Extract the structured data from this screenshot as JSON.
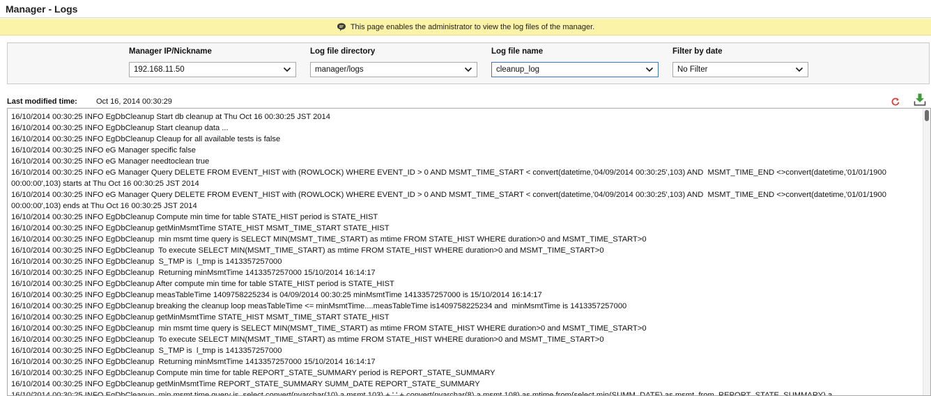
{
  "page": {
    "title": "Manager - Logs"
  },
  "banner": {
    "text": "This page enables the administrator to view the log files of the manager.",
    "icon": "speech-bubble-icon"
  },
  "filters": {
    "manager_ip": {
      "label": "Manager IP/Nickname",
      "value": "192.168.11.50"
    },
    "log_dir": {
      "label": "Log file directory",
      "value": "manager/logs"
    },
    "log_name": {
      "label": "Log file name",
      "value": "cleanup_log"
    },
    "filter_date": {
      "label": "Filter by date",
      "value": "No Filter"
    }
  },
  "meta": {
    "last_modified_label": "Last modified time:",
    "last_modified_value": "Oct 16, 2014 00:30:29",
    "refresh_icon": "refresh-icon",
    "download_icon": "download-icon"
  },
  "colors": {
    "banner_bg": "#fbf3a8",
    "active_border": "#3d76c4",
    "refresh_red": "#d9413a",
    "download_green": "#3e9a3a"
  },
  "log": {
    "lines": [
      "16/10/2014 00:30:25 INFO EgDbCleanup Start db cleanup at Thu Oct 16 00:30:25 JST 2014",
      "16/10/2014 00:30:25 INFO EgDbCleanup Start cleanup data ...",
      "16/10/2014 00:30:25 INFO EgDbCleanup Cleaup for all available tests is false",
      "16/10/2014 00:30:25 INFO eG Manager specific false",
      "16/10/2014 00:30:25 INFO eG Manager needtoclean true",
      "16/10/2014 00:30:25 INFO eG Manager Query DELETE FROM EVENT_HIST with (ROWLOCK) WHERE EVENT_ID > 0 AND MSMT_TIME_START < convert(datetime,'04/09/2014 00:30:25',103) AND  MSMT_TIME_END <>convert(datetime,'01/01/1900 00:00:00',103) starts at Thu Oct 16 00:30:25 JST 2014",
      "16/10/2014 00:30:25 INFO eG Manager Query DELETE FROM EVENT_HIST with (ROWLOCK) WHERE EVENT_ID > 0 AND MSMT_TIME_START < convert(datetime,'04/09/2014 00:30:25',103) AND  MSMT_TIME_END <>convert(datetime,'01/01/1900 00:00:00',103) ends at Thu Oct 16 00:30:25 JST 2014",
      "16/10/2014 00:30:25 INFO EgDbCleanup Compute min time for table STATE_HIST period is STATE_HIST",
      "16/10/2014 00:30:25 INFO EgDbCleanup getMinMsmtTime STATE_HIST MSMT_TIME_START STATE_HIST",
      "16/10/2014 00:30:25 INFO EgDbCleanup  min msmt time query is SELECT MIN(MSMT_TIME_START) as mtime FROM STATE_HIST WHERE duration>0 and MSMT_TIME_START>0",
      "16/10/2014 00:30:25 INFO EgDbCleanup  To execute SELECT MIN(MSMT_TIME_START) as mtime FROM STATE_HIST WHERE duration>0 and MSMT_TIME_START>0",
      "16/10/2014 00:30:25 INFO EgDbCleanup  S_TMP is  l_tmp is 1413357257000",
      "16/10/2014 00:30:25 INFO EgDbCleanup  Returning minMsmtTime 1413357257000 15/10/2014 16:14:17",
      "16/10/2014 00:30:25 INFO EgDbCleanup After compute min time for table STATE_HIST period is STATE_HIST",
      "16/10/2014 00:30:25 INFO EgDbCleanup measTableTime 1409758225234 is 04/09/2014 00:30:25 minMsmtTime 1413357257000 is 15/10/2014 16:14:17",
      "16/10/2014 00:30:25 INFO EgDbCleanup breaking the cleanup loop measTableTime <= minMsmtTime....measTableTime is1409758225234 and  minMsmtTime is 1413357257000",
      "16/10/2014 00:30:25 INFO EgDbCleanup getMinMsmtTime STATE_HIST MSMT_TIME_START STATE_HIST",
      "16/10/2014 00:30:25 INFO EgDbCleanup  min msmt time query is SELECT MIN(MSMT_TIME_START) as mtime FROM STATE_HIST WHERE duration>0 and MSMT_TIME_START>0",
      "16/10/2014 00:30:25 INFO EgDbCleanup  To execute SELECT MIN(MSMT_TIME_START) as mtime FROM STATE_HIST WHERE duration>0 and MSMT_TIME_START>0",
      "16/10/2014 00:30:25 INFO EgDbCleanup  S_TMP is  l_tmp is 1413357257000",
      "16/10/2014 00:30:25 INFO EgDbCleanup  Returning minMsmtTime 1413357257000 15/10/2014 16:14:17",
      "16/10/2014 00:30:25 INFO EgDbCleanup Compute min time for table REPORT_STATE_SUMMARY period is REPORT_STATE_SUMMARY",
      "16/10/2014 00:30:25 INFO EgDbCleanup getMinMsmtTime REPORT_STATE_SUMMARY SUMM_DATE REPORT_STATE_SUMMARY",
      "16/10/2014 00:30:25 INFO EgDbCleanup  min msmt time query is  select convert(nvarchar(10),a.msmt,103) + ' ' + convert(nvarchar(8),a.msmt,108) as mtime from(select min(SUMM_DATE) as msmt  from  REPORT_STATE_SUMMARY) a"
    ]
  }
}
